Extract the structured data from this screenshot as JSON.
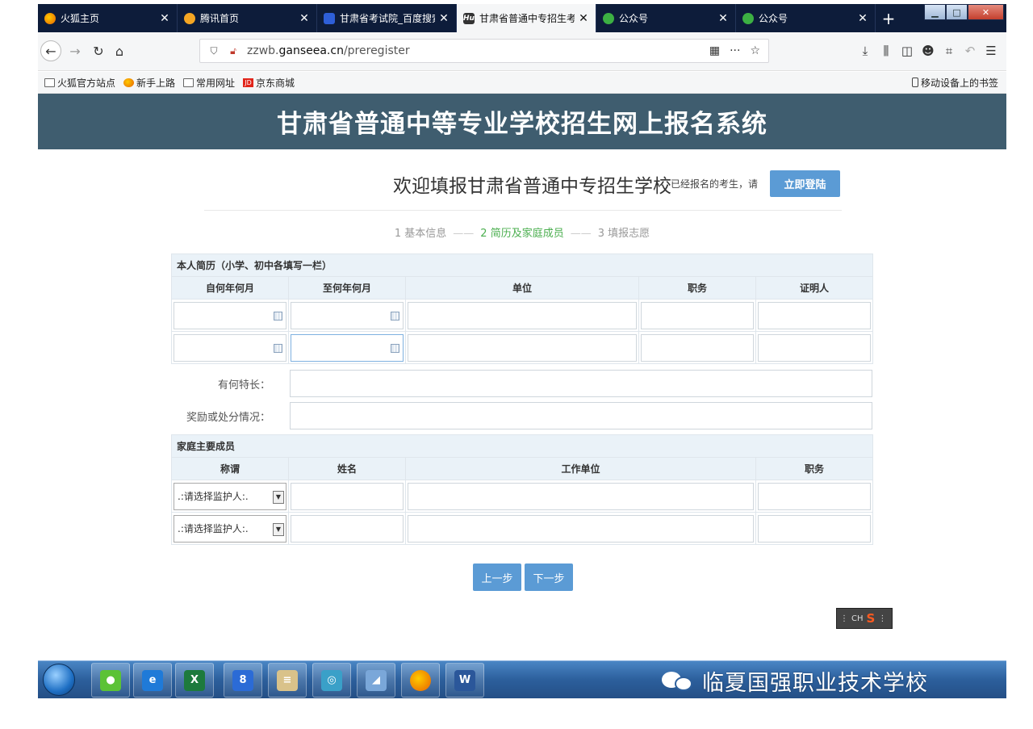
{
  "browser": {
    "tabs": [
      {
        "title": "火狐主页",
        "icon": "firefox-icon",
        "active": false
      },
      {
        "title": "腾讯首页",
        "icon": "tencent-icon",
        "active": false
      },
      {
        "title": "甘肃省考试院_百度搜索",
        "icon": "baidu-icon",
        "active": false
      },
      {
        "title": "甘肃省普通中专招生考生网",
        "icon": "site-icon",
        "active": true
      },
      {
        "title": "公众号",
        "icon": "wechat-mp-icon",
        "active": false
      },
      {
        "title": "公众号",
        "icon": "wechat-mp-icon",
        "active": false
      }
    ],
    "url_prefix": "zzwb.",
    "url_domain": "ganseea.cn",
    "url_path": "/preregister",
    "bookmarks": [
      {
        "label": "火狐官方站点",
        "icon": "folder-icon"
      },
      {
        "label": "新手上路",
        "icon": "firefox-icon"
      },
      {
        "label": "常用网址",
        "icon": "folder-icon"
      },
      {
        "label": "京东商城",
        "icon": "jd-icon"
      }
    ],
    "mobile_bookmarks": "移动设备上的书签"
  },
  "page": {
    "site_title": "甘肃省普通中等专业学校招生网上报名系统",
    "welcome": "欢迎填报甘肃省普通中专招生学校",
    "login_hint": "已经报名的考生，请",
    "login_button": "立即登陆",
    "steps": {
      "s1": "1 基本信息",
      "s2": "2 简历及家庭成员",
      "s3": "3 填报志愿",
      "sep": "——"
    },
    "resume": {
      "section_title": "本人简历（小学、初中各填写一栏）",
      "headers": [
        "自何年何月",
        "至何年何月",
        "单位",
        "职务",
        "证明人"
      ]
    },
    "specialty_label": "有何特长：",
    "rewards_label": "奖励或处分情况：",
    "family": {
      "section_title": "家庭主要成员",
      "headers": [
        "称谓",
        "姓名",
        "工作单位",
        "职务"
      ],
      "select_value": ".:请选择监护人:."
    },
    "prev_button": "上一步",
    "next_button": "下一步",
    "ime_label": "CH"
  },
  "watermark": "临夏国强职业技术学校",
  "colors": {
    "header_bg": "#3f5d6f",
    "button": "#5b9bd5",
    "current_step": "#4caf50",
    "table_head": "#eaf2f8"
  }
}
